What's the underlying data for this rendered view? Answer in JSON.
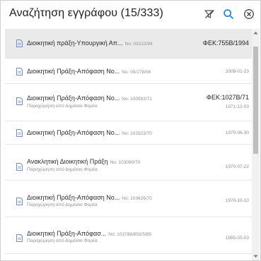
{
  "header": {
    "title": "Αναζήτηση εγγράφου (15/333)",
    "icons": [
      "filter-off-icon",
      "search-icon",
      "close-icon"
    ],
    "accent_color": "#1e88e5"
  },
  "documents": [
    {
      "title": "Διοικητική πράξη-Υπουργική Απ...",
      "number": "No: 03212/94",
      "subtitle": "",
      "right_main": "ΦΕΚ:755Β/1994",
      "date": "",
      "selected": true
    },
    {
      "title": "Διοικητική Πράξη-Απόφαση No...",
      "number": "No: 08/278/08",
      "subtitle": "",
      "right_main": "",
      "date": "2008-01-23",
      "selected": false
    },
    {
      "title": "Διοικητική Πράξη-Απόφαση No...",
      "number": "No: 100593/71",
      "subtitle": "Παραχώρηση από Δημόσιο Φορέα",
      "right_main": "ΦΕΚ:1027Β/71",
      "date": "1971-12-03",
      "selected": false
    },
    {
      "title": "Διοικητική Πράξη-Απόφαση No...",
      "number": "No: 102923/70",
      "subtitle": "",
      "right_main": "",
      "date": "1970-06-30",
      "selected": false
    },
    {
      "title": "Ανακλητική Διοικητική Πράξη",
      "number": "No: 103090/70",
      "subtitle": "Παραχώρηση από Δημόσιο Φορέα",
      "right_main": "",
      "date": "1970-07-22",
      "selected": false
    },
    {
      "title": "Διοικητική Πράξη-Απόφαση No...",
      "number": "No: 103626/70",
      "subtitle": "Παραχώρηση από Δημόσιο Φορέα",
      "right_main": "",
      "date": "1970-10-10",
      "selected": false
    },
    {
      "title": "Διοικητική Πράξη-Απόφασ...",
      "number": "No: 103788/853/5/85",
      "subtitle": "Παραχώρηση από Δημόσιο Φορέα",
      "right_main": "",
      "date": "1985-05-03",
      "selected": false
    }
  ]
}
